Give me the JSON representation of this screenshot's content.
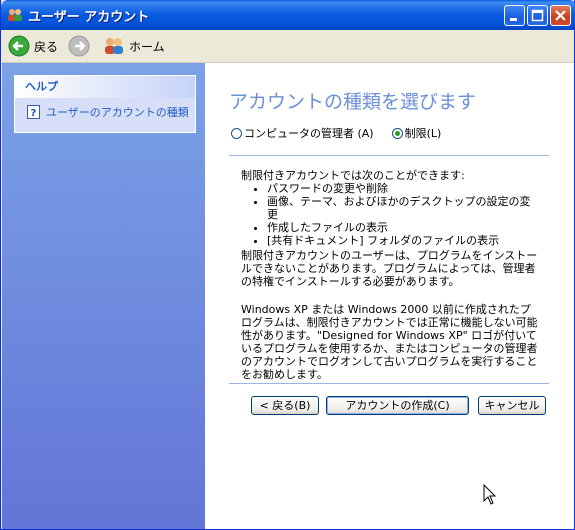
{
  "window": {
    "title": "ユーザー アカウント",
    "controls": {
      "minimize": "minimize",
      "maximize": "maximize",
      "close": "close"
    }
  },
  "toolbar": {
    "back_label": "戻る",
    "home_label": "ホーム"
  },
  "sidebar": {
    "help_title": "ヘルプ",
    "help_link": "ユーザーのアカウントの種類"
  },
  "main": {
    "title": "アカウントの種類を選びます",
    "option_admin": "コンピュータの管理者 (A)",
    "option_limited": "制限(L)",
    "selected_option": "limited",
    "intro": "制限付きアカウントでは次のことができます:",
    "bullets": [
      "パスワードの変更や削除",
      "画像、テーマ、およびほかのデスクトップの設定の変更",
      "作成したファイルの表示",
      "[共有ドキュメント] フォルダのファイルの表示"
    ],
    "paragraph2": "制限付きアカウントのユーザーは、プログラムをインストールできないことがあります。プログラムによっては、管理者の特権でインストールする必要があります。",
    "paragraph3": "Windows XP または Windows 2000 以前に作成されたプログラムは、制限付きアカウントでは正常に機能しない可能性があります。\"Designed for Windows XP\" ロゴが付いているプログラムを使用するか、またはコンピュータの管理者のアカウントでログオンして古いプログラムを実行することをお勧めします。"
  },
  "buttons": {
    "back": "< 戻る(B)",
    "create": "アカウントの作成(C)",
    "cancel": "キャンセル"
  },
  "colors": {
    "title_bar": "#0a5adf",
    "sidebar_top": "#7ba2e7",
    "sidebar_bottom": "#6375d6",
    "page_title": "#6d8fd9",
    "link": "#215dc6"
  }
}
